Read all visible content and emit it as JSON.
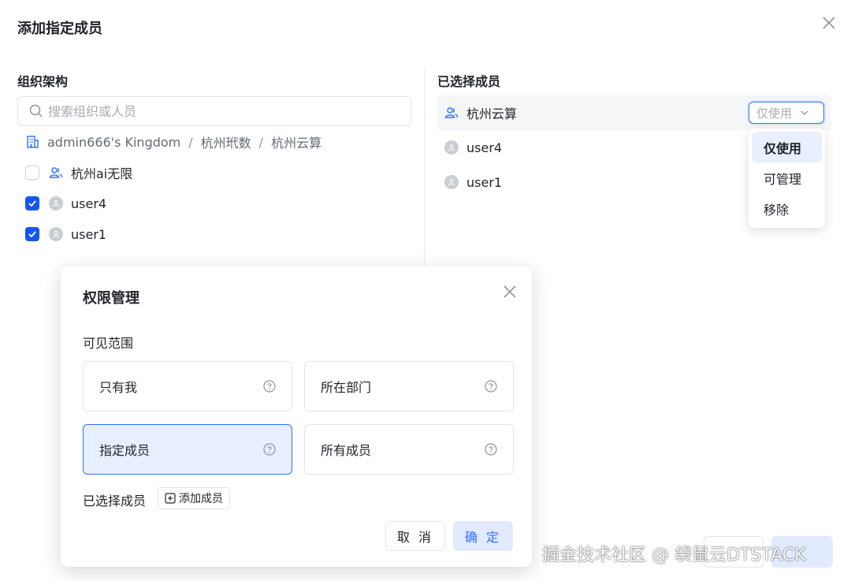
{
  "dialog": {
    "title": "添加指定成员",
    "close_icon": "close-icon"
  },
  "org": {
    "title": "组织架构",
    "search_placeholder": "搜索组织或人员",
    "breadcrumb": [
      "admin666's Kingdom",
      "杭州玳数",
      "杭州云算"
    ],
    "items": [
      {
        "label": "杭州ai无限",
        "type": "team",
        "checked": false
      },
      {
        "label": "user4",
        "type": "user",
        "checked": true
      },
      {
        "label": "user1",
        "type": "user",
        "checked": true
      }
    ]
  },
  "selected": {
    "title": "已选择成员",
    "items": [
      {
        "label": "杭州云算",
        "type": "team"
      },
      {
        "label": "user4",
        "type": "user"
      },
      {
        "label": "user1",
        "type": "user"
      }
    ],
    "permission_select": "仅使用",
    "permission_options": [
      "仅使用",
      "可管理",
      "移除"
    ]
  },
  "modal": {
    "title": "权限管理",
    "scope_label": "可见范围",
    "options": [
      "只有我",
      "所在部门",
      "指定成员",
      "所有成员"
    ],
    "selected_option": "指定成员",
    "selected_members_label": "已选择成员",
    "add_member": "添加成员",
    "cancel": "取 消",
    "ok": "确 定"
  },
  "watermark": "掘金技术社区 @ 袋鼠云DTSTACK",
  "colors": {
    "primary": "#3370ff",
    "checkbox": "#1456f0",
    "selected_bg": "#e8effe"
  }
}
